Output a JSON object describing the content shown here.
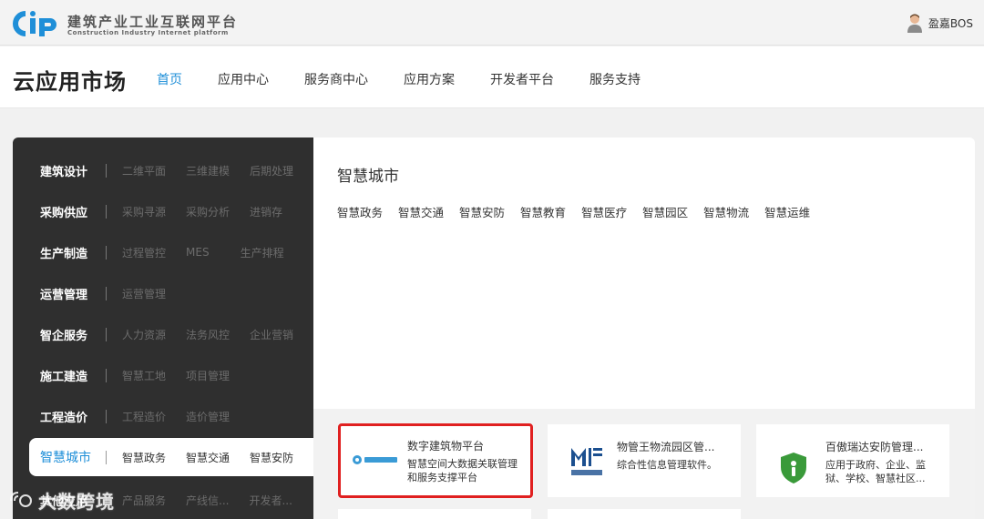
{
  "topbar": {
    "logo_mark": "CiP",
    "logo_cn": "建筑产业工业互联网平台",
    "logo_en": "Construction Industry Internet platform",
    "user_name": "盈嘉BOS"
  },
  "header": {
    "brand": "云应用市场",
    "nav": [
      {
        "label": "首页",
        "active": true
      },
      {
        "label": "应用中心"
      },
      {
        "label": "服务商中心"
      },
      {
        "label": "应用方案"
      },
      {
        "label": "开发者平台"
      },
      {
        "label": "服务支持"
      }
    ]
  },
  "categories": [
    {
      "title": "建筑设计",
      "subs": [
        "二维平面",
        "三维建模",
        "后期处理"
      ]
    },
    {
      "title": "采购供应",
      "subs": [
        "采购寻源",
        "采购分析",
        "进销存"
      ]
    },
    {
      "title": "生产制造",
      "subs": [
        "过程管控",
        "MES",
        "生产排程"
      ]
    },
    {
      "title": "运营管理",
      "subs": [
        "运营管理"
      ]
    },
    {
      "title": "智企服务",
      "subs": [
        "人力资源",
        "法务风控",
        "企业营销"
      ]
    },
    {
      "title": "施工建造",
      "subs": [
        "智慧工地",
        "项目管理"
      ]
    },
    {
      "title": "工程造价",
      "subs": [
        "工程造价",
        "造价管理"
      ]
    },
    {
      "title": "智慧城市",
      "subs": [
        "智慧政务",
        "智慧交通",
        "智慧安防"
      ],
      "active": true
    },
    {
      "title": "其他应用",
      "subs": [
        "产品服务",
        "产线信...",
        "开发者..."
      ]
    }
  ],
  "panel": {
    "title": "智慧城市",
    "tags": [
      "智慧政务",
      "智慧交通",
      "智慧安防",
      "智慧教育",
      "智慧医疗",
      "智慧园区",
      "智慧物流",
      "智慧运维"
    ]
  },
  "apps": [
    {
      "title": "数字建筑物平台",
      "desc": "智慧空间大数据关联管理和服务支撑平台",
      "icon": "digital-building-logo",
      "selected": true
    },
    {
      "title": "物管王物流园区管...",
      "desc": "综合性信息管理软件。",
      "icon": "wuguanwang-logo"
    },
    {
      "title": "百傲瑞达安防管理...",
      "desc": "应用于政府、企业、监狱、学校、智慧社区...",
      "icon": "shield-logo"
    }
  ],
  "watermark": "大数跨境",
  "colors": {
    "accent": "#1f8fd8",
    "menu_bg": "#2f2f2f",
    "highlight": "#e02020"
  }
}
